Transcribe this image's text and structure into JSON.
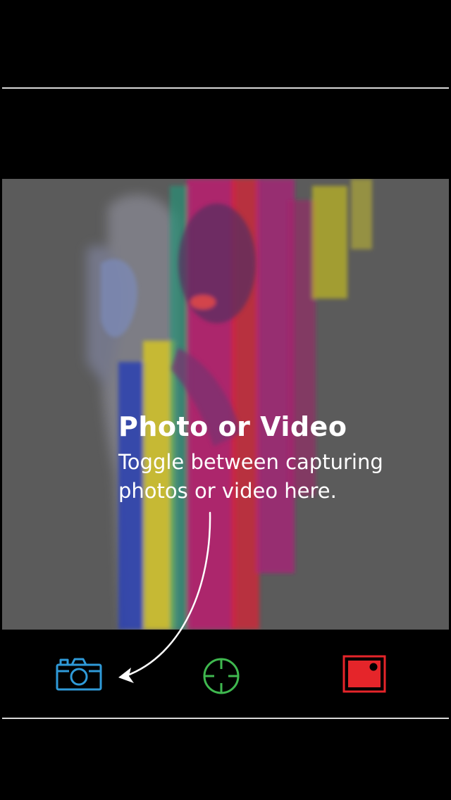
{
  "coach_mark": {
    "title": "Photo or Video",
    "body": "Toggle between capturing photos or video here."
  },
  "toolbar": {
    "mode_toggle": {
      "icon": "camera-icon",
      "color": "#2f9ad8"
    },
    "focus": {
      "icon": "crosshair-icon",
      "color": "#3fb84f"
    },
    "record": {
      "icon": "video-record-icon",
      "color": "#e5252a"
    }
  },
  "colors": {
    "background": "#000000",
    "overlay_gray": "#5b5b5b",
    "divider": "#d9d9d9",
    "text": "#ffffff"
  }
}
